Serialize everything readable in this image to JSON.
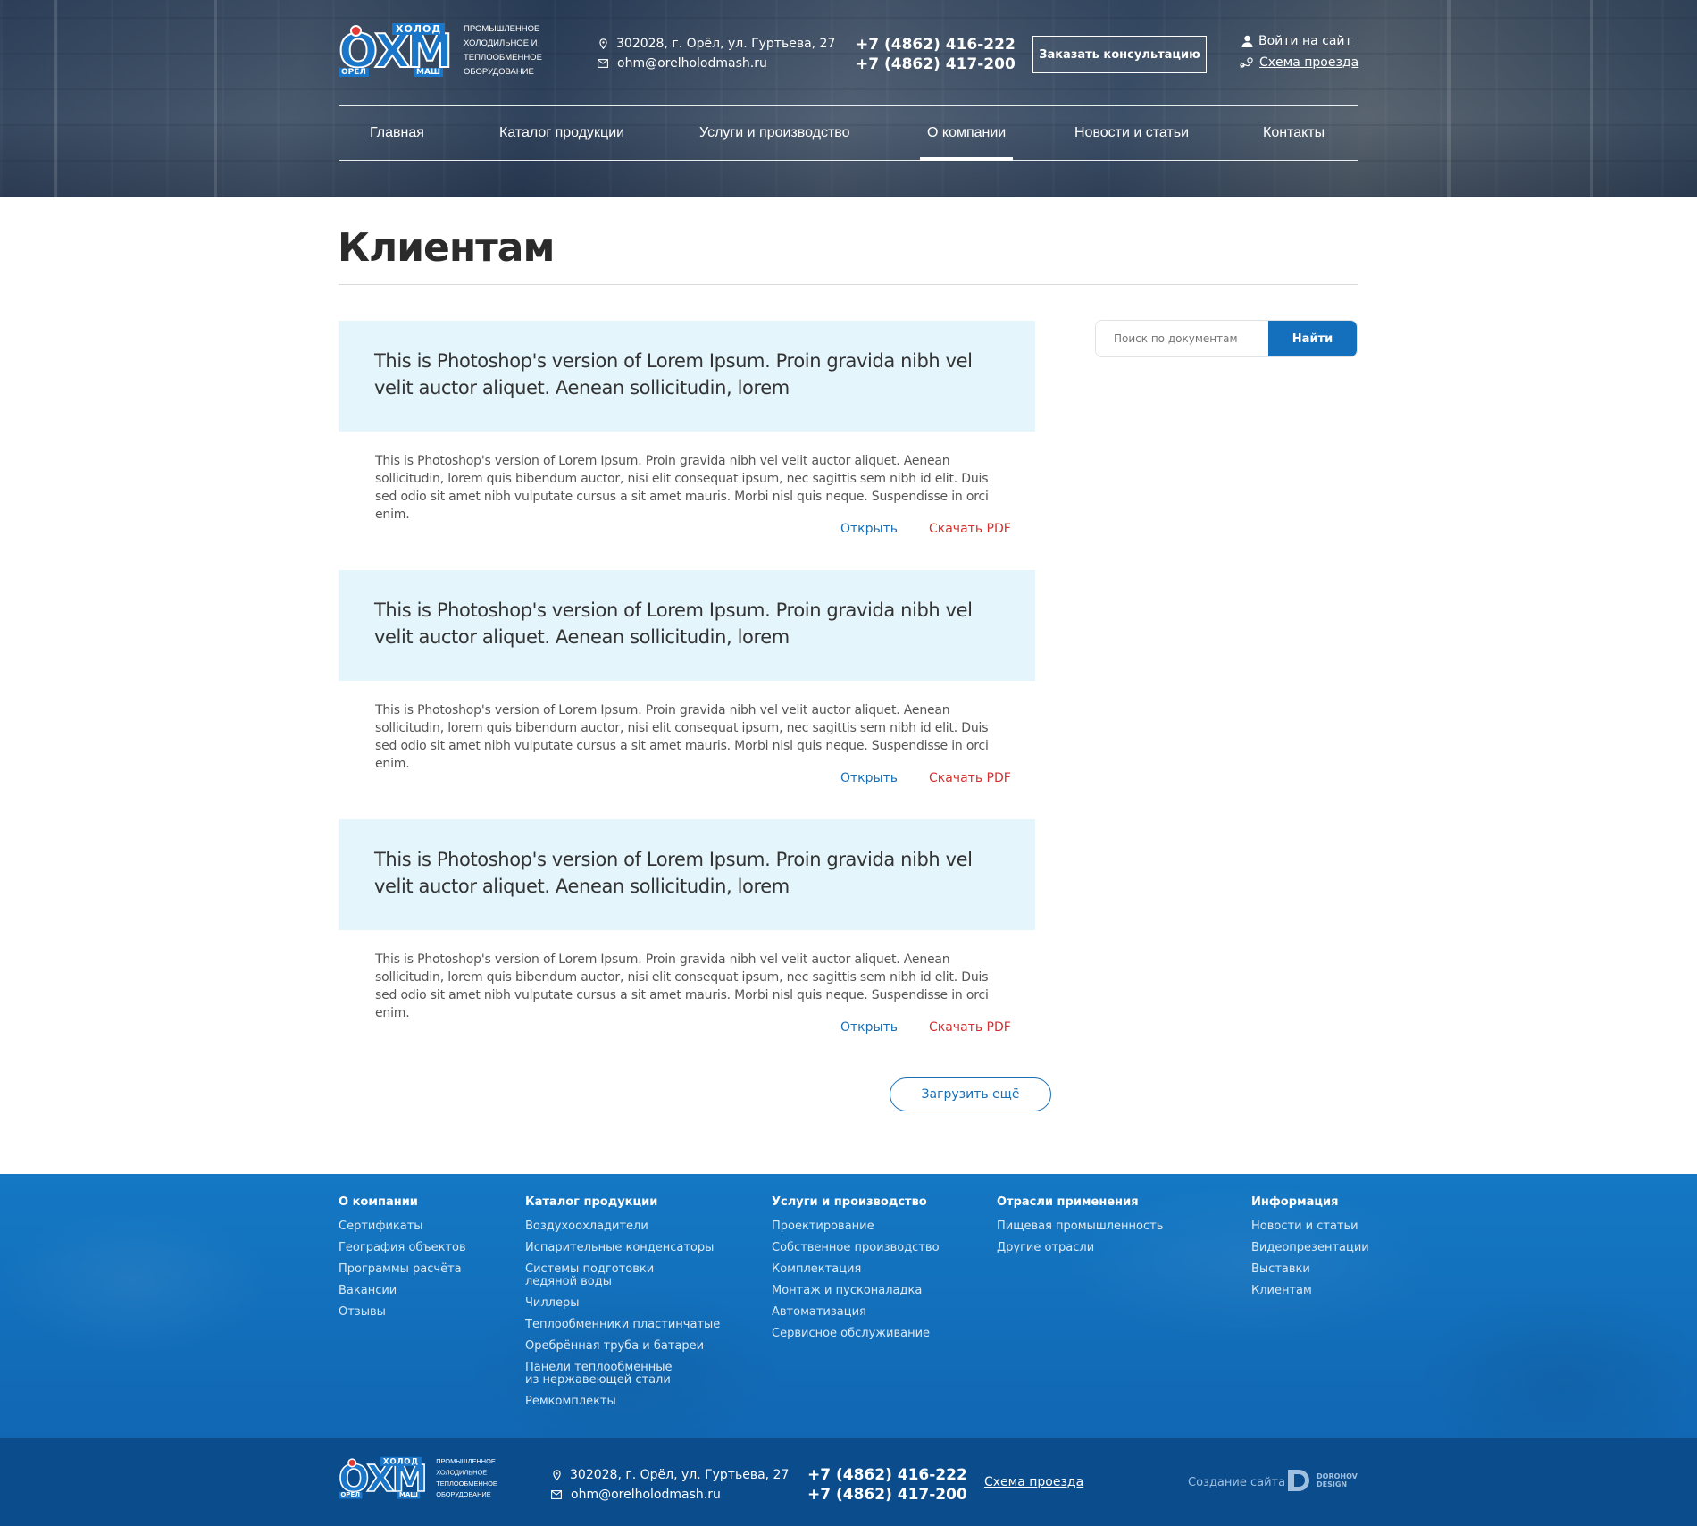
{
  "brand": {
    "logo_top": "ХОЛОД",
    "logo_main": "ОХМ",
    "logo_left": "ОРЕЛ",
    "logo_right": "МАШ",
    "tagline_lines": [
      "ПРОМЫШЛЕННОЕ",
      "ХОЛОДИЛЬНОЕ И",
      "ТЕПЛООБМЕННОЕ",
      "ОБОРУДОВАНИЕ"
    ],
    "footer_tagline_lines": [
      "ПРОМЫШЛЕННОЕ",
      "ХОЛОДИЛЬНОЕ",
      "ТЕПЛООБМЕННОЕ",
      "ОБОРУДОВАНИЕ"
    ]
  },
  "header": {
    "address": "302028, г. Орёл, ул. Гуртьева, 27",
    "email": "ohm@orelholodmash.ru",
    "phone1": "+7 (4862) 416-222",
    "phone2": "+7 (4862) 417-200",
    "consult_label": "Заказать консультацию",
    "login_label": "Войти на сайт",
    "scheme_label": "Схема проезда"
  },
  "nav": {
    "items": [
      {
        "label": "Главная"
      },
      {
        "label": "Каталог продукции"
      },
      {
        "label": "Услуги и производство"
      },
      {
        "label": "О компании"
      },
      {
        "label": "Новости и статьи"
      },
      {
        "label": "Контакты"
      }
    ],
    "active": "О компании"
  },
  "page": {
    "title": "Клиентам"
  },
  "search": {
    "placeholder": "Поиск по документам",
    "button_label": "Найти"
  },
  "documents": [
    {
      "title": "This is Photoshop's version  of Lorem Ipsum. Proin gravida nibh vel velit auctor aliquet. Aenean sollicitudin, lorem",
      "body": "This is Photoshop's version  of Lorem Ipsum. Proin gravida nibh vel velit auctor aliquet. Aenean sollicitudin, lorem quis bibendum auctor, nisi elit consequat ipsum, nec sagittis sem nibh id elit. Duis sed odio sit amet nibh vulputate cursus a sit amet mauris. Morbi nisl quis neque. Suspendisse in orci enim.",
      "open_label": "Открыть",
      "pdf_label": "Скачать PDF"
    },
    {
      "title": "This is Photoshop's version  of Lorem Ipsum. Proin gravida nibh vel velit auctor aliquet. Aenean sollicitudin, lorem",
      "body": "This is Photoshop's version  of Lorem Ipsum. Proin gravida nibh vel velit auctor aliquet. Aenean sollicitudin, lorem quis bibendum auctor, nisi elit consequat ipsum, nec sagittis sem nibh id elit. Duis sed odio sit amet nibh vulputate cursus a sit amet mauris. Morbi nisl quis neque. Suspendisse in orci enim.",
      "open_label": "Открыть",
      "pdf_label": "Скачать PDF"
    },
    {
      "title": "This is Photoshop's version  of Lorem Ipsum. Proin gravida nibh vel velit auctor aliquet. Aenean sollicitudin, lorem",
      "body": "This is Photoshop's version  of Lorem Ipsum. Proin gravida nibh vel velit auctor aliquet. Aenean sollicitudin, lorem quis bibendum auctor, nisi elit consequat ipsum, nec sagittis sem nibh id elit. Duis sed odio sit amet nibh vulputate cursus a sit amet mauris. Morbi nisl quis neque. Suspendisse in orci enim.",
      "open_label": "Открыть",
      "pdf_label": "Скачать PDF"
    }
  ],
  "load_more_label": "Загрузить ещё",
  "footer": {
    "columns": [
      {
        "title": "О компании",
        "links": [
          "Сертификаты",
          "География объектов",
          "Программы расчёта",
          "Вакансии",
          "Отзывы"
        ]
      },
      {
        "title": "Каталог продукции",
        "links": [
          "Воздухоохладители",
          "Испарительные конденсаторы",
          "Системы подготовки ледяной воды",
          "Чиллеры",
          "Теплообменники пластинчатые",
          "Оребрённая труба и батареи",
          "Панели теплообменные из нержавеющей стали",
          "Ремкомплекты"
        ]
      },
      {
        "title": "Услуги и производство",
        "links": [
          "Проектирование",
          "Собственное производство",
          "Комплектация",
          "Монтаж и пусконаладка",
          "Автоматизация",
          "Сервисное обслуживание"
        ]
      },
      {
        "title": "Отрасли применения",
        "links": [
          "Пищевая промышленность",
          "Другие отрасли"
        ]
      },
      {
        "title": "Информация",
        "links": [
          "Новости и статьи",
          "Видеопрезентации",
          "Выставки",
          "Клиентам"
        ]
      }
    ]
  },
  "bottom_bar": {
    "address": "302028, г. Орёл, ул. Гуртьева, 27",
    "email": "ohm@orelholodmash.ru",
    "phone1": "+7 (4862) 416-222",
    "phone2": "+7 (4862) 417-200",
    "scheme_label": "Схема проезда",
    "made_by": "Создание сайта",
    "studio_lines": [
      "DOROHOV",
      "DESIGN"
    ]
  },
  "colors": {
    "accent_blue": "#1470bd",
    "light_panel": "#e4f5fc",
    "pdf_red": "#d3302f",
    "footer_blue": "#1478c4",
    "bottom_blue": "#0b4c8c"
  },
  "icons": {
    "address": "location-pin-icon",
    "email": "mail-icon",
    "login": "user-icon",
    "scheme": "map-route-icon",
    "studio": "dorohov-logo-icon"
  }
}
